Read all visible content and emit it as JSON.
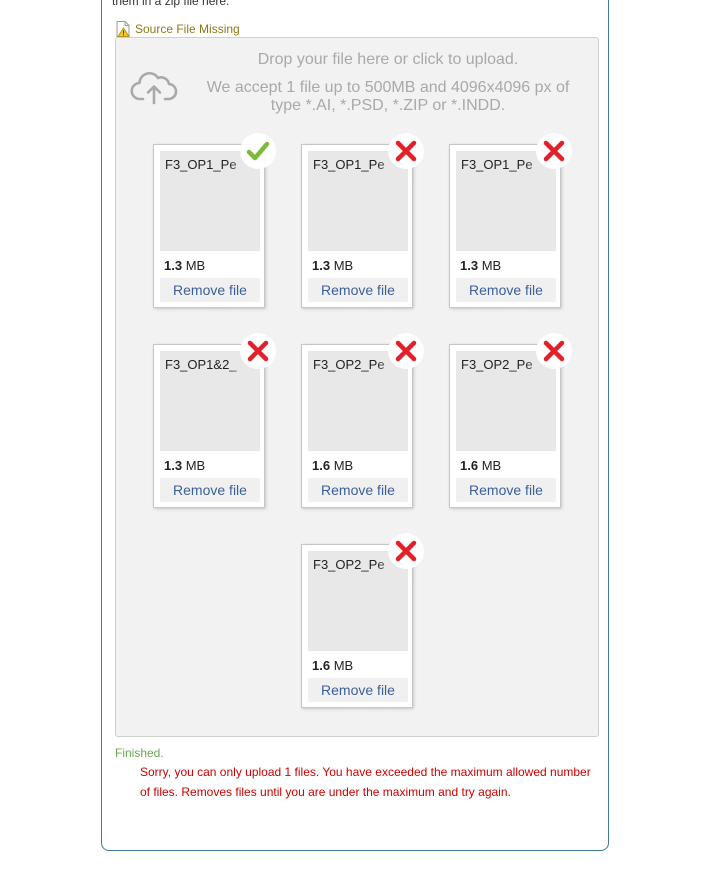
{
  "intro_text": "them in a zip file here.",
  "source_missing_label": "Source File Missing",
  "dropzone": {
    "title": "Drop your file here or click to upload.",
    "subtitle": "We accept 1 file up to 500MB and 4096x4096 px of type *.AI, *.PSD, *.ZIP or *.INDD."
  },
  "files": [
    {
      "name": "F3_OP1_Pe",
      "size_value": "1.3",
      "size_unit": "MB",
      "remove_label": "Remove file",
      "status": "success"
    },
    {
      "name": "F3_OP1_Pe",
      "size_value": "1.3",
      "size_unit": "MB",
      "remove_label": "Remove file",
      "status": "error"
    },
    {
      "name": "F3_OP1_Pe",
      "size_value": "1.3",
      "size_unit": "MB",
      "remove_label": "Remove file",
      "status": "error"
    },
    {
      "name": "F3_OP1&2_",
      "size_value": "1.3",
      "size_unit": "MB",
      "remove_label": "Remove file",
      "status": "error"
    },
    {
      "name": "F3_OP2_Pe",
      "size_value": "1.6",
      "size_unit": "MB",
      "remove_label": "Remove file",
      "status": "error"
    },
    {
      "name": "F3_OP2_Pe",
      "size_value": "1.6",
      "size_unit": "MB",
      "remove_label": "Remove file",
      "status": "error"
    },
    {
      "name": "F3_OP2_Pe",
      "size_value": "1.6",
      "size_unit": "MB",
      "remove_label": "Remove file",
      "status": "error"
    }
  ],
  "status": {
    "finished_label": "Finished.",
    "error_message": "Sorry, you can only upload 1 files. You have exceeded the maximum allowed number of files. Removes files until you are under the maximum and try again."
  },
  "colors": {
    "success": "#7dba3c",
    "error": "#e3202a",
    "border": "#3f7a91",
    "link": "#3c5f9a"
  },
  "icons": {
    "warning": "warning-document-icon",
    "upload": "cloud-upload-icon",
    "success": "checkmark-icon",
    "error": "x-icon"
  }
}
